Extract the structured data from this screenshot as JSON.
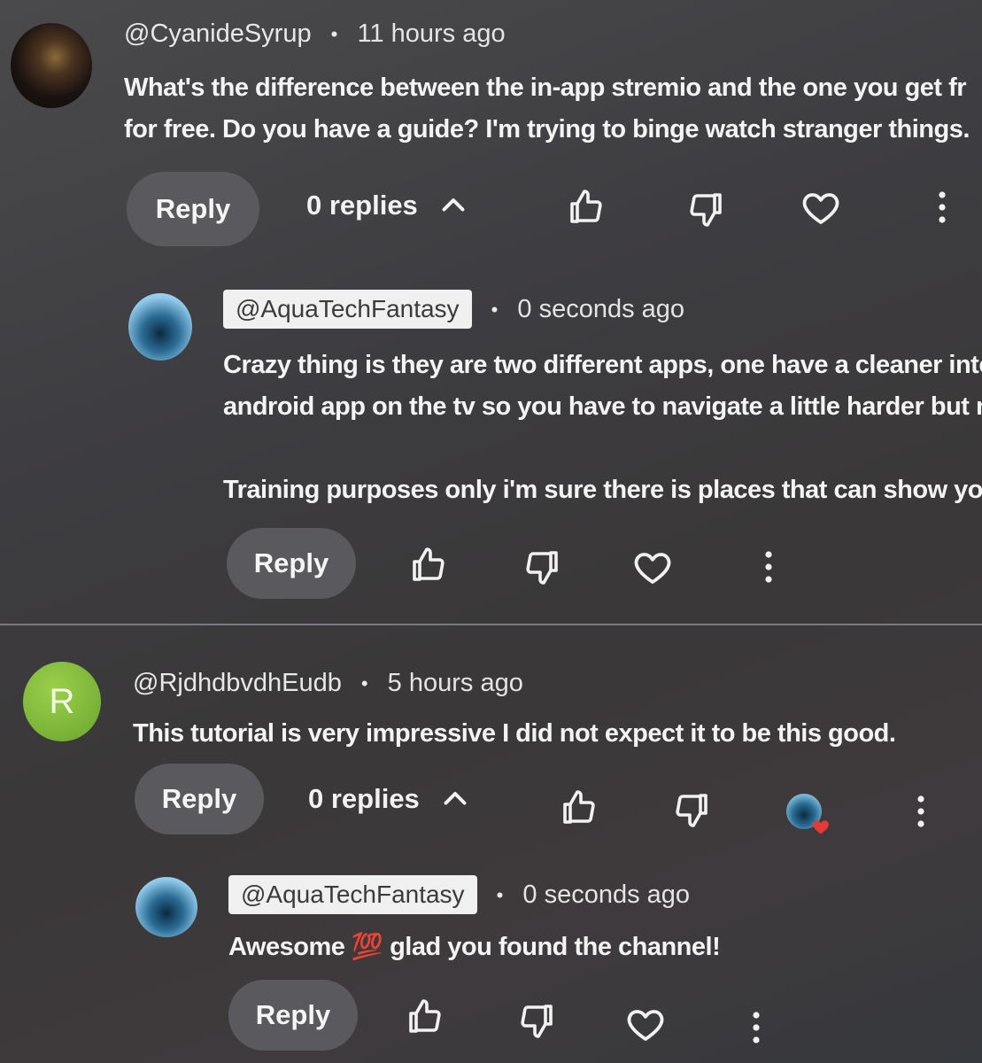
{
  "comments": [
    {
      "handle": "@CyanideSyrup",
      "dot": "•",
      "time": "11 hours ago",
      "line1": "What's the difference between the in-app stremio and the one you get fr",
      "line2": "for free. Do you have a guide? I'm trying to binge watch stranger things.",
      "reply_label": "Reply",
      "replies_label": "0 replies",
      "reply": {
        "handle": "@AquaTechFantasy",
        "dot": "•",
        "time": "0 seconds ago",
        "line1": "Crazy thing is they are two different apps, one have a cleaner inte",
        "line2": "android app on the tv so you have to navigate a little harder but n",
        "line3": "Training purposes only i'm sure there is places that can show you",
        "reply_label": "Reply"
      }
    },
    {
      "avatar_letter": "R",
      "handle": "@RjdhdbvdhEudb",
      "dot": "•",
      "time": "5 hours ago",
      "line1": "This tutorial is very impressive I did not expect it to be this good.",
      "reply_label": "Reply",
      "replies_label": "0 replies",
      "reply": {
        "handle": "@AquaTechFantasy",
        "dot": "•",
        "time": "0 seconds ago",
        "line1": "Awesome 💯 glad you found the channel!",
        "reply_label": "Reply"
      }
    }
  ],
  "icons": {
    "like": "thumbs-up-icon",
    "dislike": "thumbs-down-icon",
    "heart": "heart-icon",
    "more": "more-vert-icon",
    "chevron": "chevron-up-icon",
    "creator_heart": "creator-heart-badge"
  },
  "colors": {
    "background": "#3d3c40",
    "reply_button": "#5a5a5e",
    "handle_box": "#f0f0f0",
    "heart_badge": "#e53935"
  }
}
